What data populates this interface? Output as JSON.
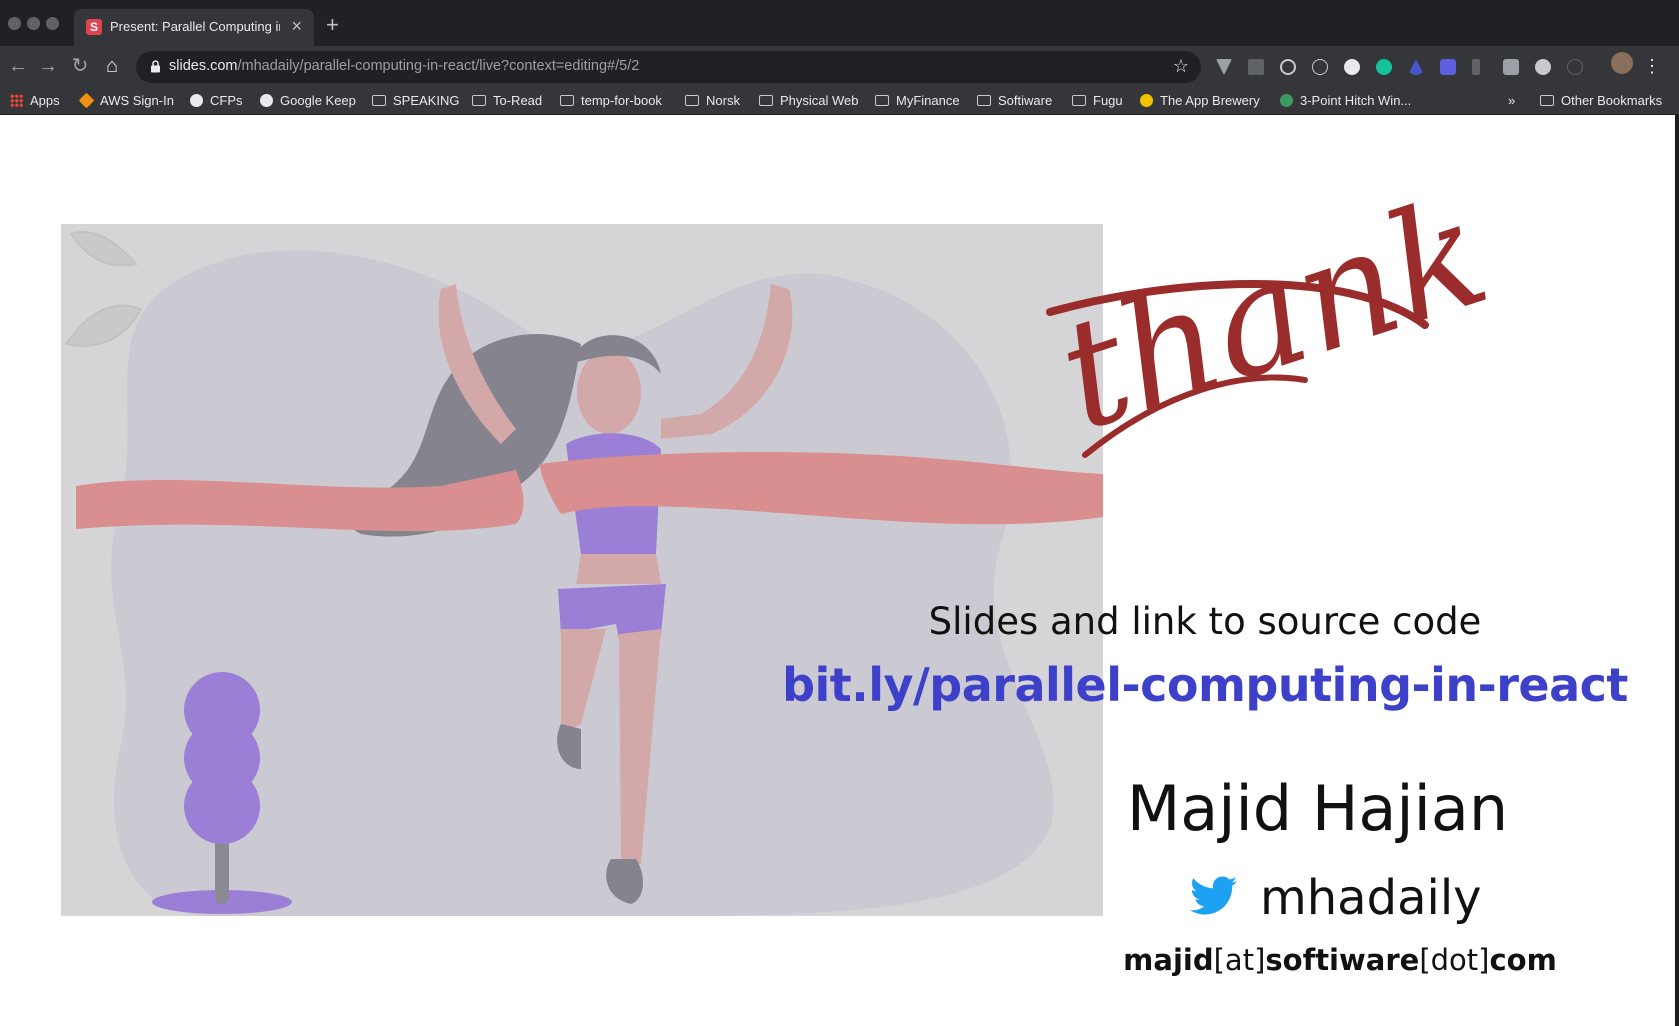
{
  "browser": {
    "tab": {
      "favicon_letter": "S",
      "title": "Present: Parallel Computing in",
      "close": "×"
    },
    "new_tab": "+",
    "nav": {
      "back": "←",
      "forward": "→",
      "reload": "↻",
      "home": "⌂"
    },
    "address": {
      "host": "slides.com",
      "path": "/mhadaily/parallel-computing-in-react/live?context=editing#/5/2"
    },
    "star": "☆",
    "menu": "⋮",
    "bookmarks_overflow": "»",
    "bookmarks": [
      {
        "label": "Apps",
        "icon": "apps-grid-icon"
      },
      {
        "label": "AWS Sign-In",
        "icon": "aws-icon"
      },
      {
        "label": "CFPs",
        "icon": "globe-icon"
      },
      {
        "label": "Google Keep",
        "icon": "globe-icon"
      },
      {
        "label": "SPEAKING",
        "icon": "folder-icon"
      },
      {
        "label": "To-Read",
        "icon": "folder-icon"
      },
      {
        "label": "temp-for-book",
        "icon": "folder-icon"
      },
      {
        "label": "Norsk",
        "icon": "folder-icon"
      },
      {
        "label": "Physical Web",
        "icon": "folder-icon"
      },
      {
        "label": "MyFinance",
        "icon": "folder-icon"
      },
      {
        "label": "Softiware",
        "icon": "folder-icon"
      },
      {
        "label": "Fugu",
        "icon": "folder-icon"
      },
      {
        "label": "The App Brewery",
        "icon": "app-brewery-icon"
      },
      {
        "label": "3-Point Hitch Win...",
        "icon": "site-icon"
      }
    ],
    "other_bookmarks": "Other Bookmarks"
  },
  "slide": {
    "thank_you": "thank you!",
    "slides_line": "Slides and link to source code",
    "link": "bit.ly/parallel-computing-in-react",
    "name": "Majid Hajian",
    "twitter_handle": "mhadaily",
    "email_parts": [
      "majid",
      "[at]",
      "softiware",
      "[dot]",
      "com"
    ],
    "colors": {
      "accent_link": "#3d40c9",
      "script": "#9b2c2c",
      "twitter": "#1da1f2",
      "ribbon": "#d98f8f",
      "purple": "#9b7fd6"
    }
  }
}
